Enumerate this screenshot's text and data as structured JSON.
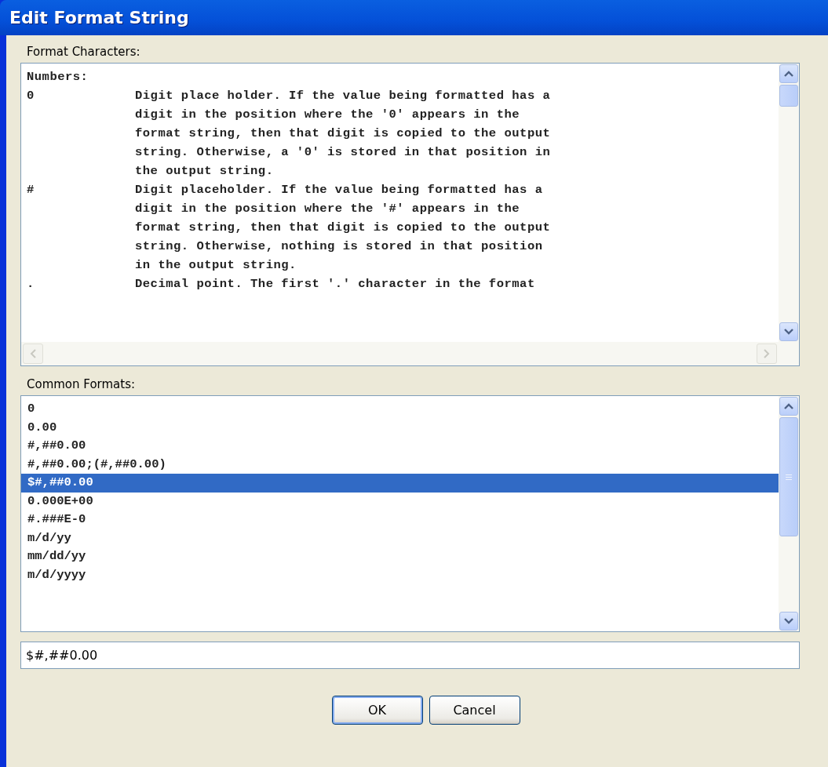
{
  "window": {
    "title": "Edit Format String"
  },
  "format_characters": {
    "label": "Format Characters:",
    "sections": [
      {
        "heading": "Numbers:",
        "entries": [
          {
            "symbol": "0",
            "lines": [
              "Digit place holder. If the value being formatted has a",
              "digit in the position where the '0' appears in the",
              "format string, then that digit is copied to the output",
              "string. Otherwise, a '0' is stored in that position in",
              "the output string."
            ]
          },
          {
            "symbol": "#",
            "lines": [
              "Digit placeholder. If the value being formatted has a",
              "digit in the position where the '#' appears in the",
              "format string, then that digit is copied to the output",
              "string. Otherwise, nothing is stored in that position",
              "in the output string."
            ]
          },
          {
            "symbol": ".",
            "lines": [
              "Decimal point. The first '.' character in the format"
            ]
          }
        ]
      }
    ]
  },
  "common_formats": {
    "label": "Common Formats:",
    "items": [
      {
        "text": "0",
        "selected": false
      },
      {
        "text": "0.00",
        "selected": false
      },
      {
        "text": "#,##0.00",
        "selected": false
      },
      {
        "text": "#,##0.00;(#,##0.00)",
        "selected": false
      },
      {
        "text": "$#,##0.00",
        "selected": true
      },
      {
        "text": "0.000E+00",
        "selected": false
      },
      {
        "text": "#.###E-0",
        "selected": false
      },
      {
        "text": "m/d/yy",
        "selected": false
      },
      {
        "text": "mm/dd/yy",
        "selected": false
      },
      {
        "text": "m/d/yyyy",
        "selected": false
      }
    ]
  },
  "format_field": {
    "value": "$#,##0.00"
  },
  "buttons": [
    {
      "label": "OK",
      "default": true
    },
    {
      "label": "Cancel",
      "default": false
    }
  ]
}
